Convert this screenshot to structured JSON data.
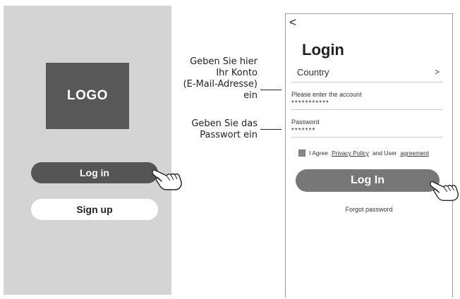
{
  "left_screen": {
    "logo_text": "LOGO",
    "login_button": "Log in",
    "signup_button": "Sign up"
  },
  "annotations": {
    "account_hint": [
      "Geben Sie hier",
      "Ihr Konto",
      "(E-Mail-Adresse)",
      "ein"
    ],
    "password_hint": [
      "Geben Sie das",
      "Passwort ein"
    ]
  },
  "right_screen": {
    "back_symbol": "<",
    "title": "Login",
    "country_label": "Country",
    "country_chevron": ">",
    "account_label": "Please enter the account",
    "account_value": "***********",
    "password_label": "Password",
    "password_value": "*******",
    "agree_prefix": "I Agree",
    "privacy_link": "Privacy Policy",
    "agree_middle": "and User",
    "agreement_link": "agreement",
    "login_button": "Log In",
    "forgot_password": "Forgot password"
  },
  "icons": {
    "hand_pointer": "hand-pointer-icon",
    "checkbox": "checkbox-icon"
  }
}
